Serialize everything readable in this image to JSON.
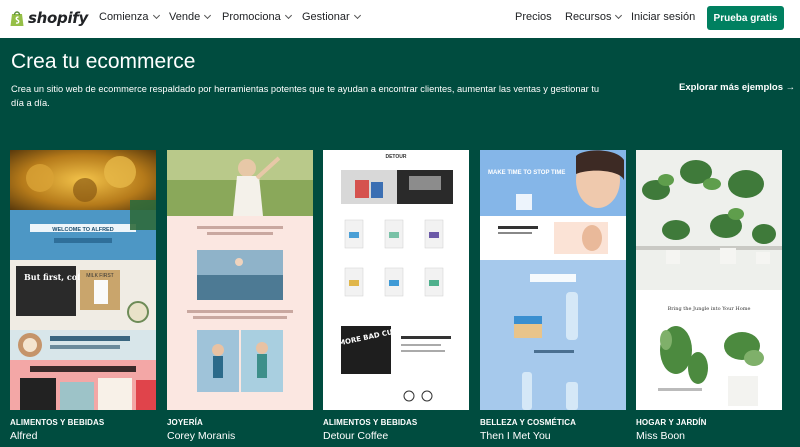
{
  "header": {
    "logo_text": "shopify",
    "nav": [
      "Comienza",
      "Vende",
      "Promociona",
      "Gestionar"
    ],
    "right": [
      "Precios",
      "Recursos",
      "Iniciar sesión"
    ],
    "cta": "Prueba gratis"
  },
  "hero": {
    "title": "Crea tu ecommerce",
    "description": "Crea un sitio web de ecommerce respaldado por herramientas potentes que te ayudan a encontrar clientes, aumentar las ventas y gestionar tu día a día.",
    "explore": "Explorar más ejemplos"
  },
  "thumb_text": {
    "alfred_welcome": "WELCOME TO ALFRED",
    "alfred_but": "But first, coffee.",
    "alfred_milk": "MILK FIRST",
    "betty_logo": "DETOUR",
    "detour_poster": "NO MORE BAD CUPS",
    "thenimetyou_hero": "MAKE TIME TO STOP TIME",
    "missboon_tag": "Bring the Jungle into Your Home"
  },
  "cards": [
    {
      "category": "ALIMENTOS Y BEBIDAS",
      "name": "Alfred"
    },
    {
      "category": "JOYERÍA",
      "name": "Corey Moranis"
    },
    {
      "category": "ALIMENTOS Y BEBIDAS",
      "name": "Detour Coffee"
    },
    {
      "category": "BELLEZA Y COSMÉTICA",
      "name": "Then I Met You"
    },
    {
      "category": "HOGAR Y JARDÍN",
      "name": "Miss Boon"
    }
  ],
  "colors": {
    "brand_green": "#004c3f",
    "cta_green": "#008060",
    "logo_green": "#95bf47"
  }
}
